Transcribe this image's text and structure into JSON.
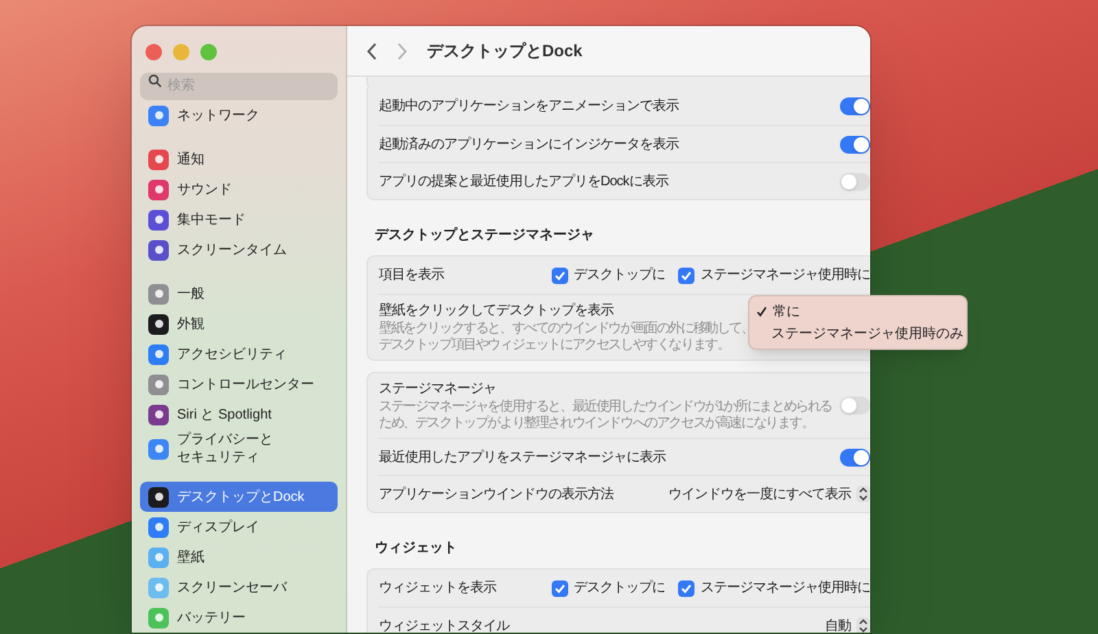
{
  "window": {
    "title": "デスクトップとDock",
    "controls": [
      {
        "color": "#ec5f57"
      },
      {
        "color": "#e8b73a"
      },
      {
        "color": "#5fc33f"
      }
    ]
  },
  "sidebar": {
    "search": {
      "placeholder": "検索"
    },
    "groups": [
      [
        {
          "label": "ネットワーク",
          "color": "#3b82f6",
          "selected": false
        }
      ],
      [
        {
          "label": "通知",
          "color": "#e5484d",
          "selected": false
        },
        {
          "label": "サウンド",
          "color": "#e0386a",
          "selected": false
        },
        {
          "label": "集中モード",
          "color": "#5b4fd6",
          "selected": false
        },
        {
          "label": "スクリーンタイム",
          "color": "#5a4fc9",
          "selected": false
        }
      ],
      [
        {
          "label": "一般",
          "color": "#8e8e93",
          "selected": false
        },
        {
          "label": "外観",
          "color": "#1c1c1e",
          "selected": false
        },
        {
          "label": "アクセシビリティ",
          "color": "#2f7df6",
          "selected": false
        },
        {
          "label": "コントロールセンター",
          "color": "#8e8e93",
          "selected": false
        },
        {
          "label": "Siri と Spotlight",
          "color": "#7a3b8f",
          "selected": false
        },
        {
          "label_lines": [
            "プライバシーと",
            "セキュリティ"
          ],
          "color": "#3d86f5",
          "selected": false
        }
      ],
      [
        {
          "label": "デスクトップとDock",
          "color": "#1c1c1e",
          "selected": true
        },
        {
          "label": "ディスプレイ",
          "color": "#2f7df6",
          "selected": false
        },
        {
          "label": "壁紙",
          "color": "#5ab0f0",
          "selected": false
        },
        {
          "label": "スクリーンセーバ",
          "color": "#6cbcf0",
          "selected": false
        },
        {
          "label": "バッテリー",
          "color": "#4cc25a",
          "selected": false
        }
      ]
    ]
  },
  "sections": [
    {
      "cards": [
        {
          "rows": [
            {
              "kind": "toggle",
              "label": "起動中のアプリケーションをアニメーションで表示",
              "on": true
            },
            {
              "kind": "toggle",
              "label": "起動済みのアプリケーションにインジケータを表示",
              "on": true
            },
            {
              "kind": "toggle",
              "label": "アプリの提案と最近使用したアプリをDockに表示",
              "on": false
            }
          ]
        }
      ]
    },
    {
      "title": "デスクトップとステージマネージャ",
      "cards": [
        {
          "rows": [
            {
              "kind": "checks",
              "label": "項目を表示",
              "options": [
                {
                  "label": "デスクトップに",
                  "checked": true
                },
                {
                  "label": "ステージマネージャ使用時に",
                  "checked": true
                }
              ]
            },
            {
              "kind": "info",
              "label": "壁紙をクリックしてデスクトップを表示",
              "description_lines": [
                "壁紙をクリックすると、すべてのウインドウが画面の外に移動して、",
                "デスクトップ項目やウィジェットにアクセスしやすくなります。"
              ]
            }
          ]
        },
        {
          "rows": [
            {
              "kind": "toggle",
              "label": "ステージマネージャ",
              "description_lines": [
                "ステージマネージャを使用すると、最近使用したウインドウが1か所にまとめられる",
                "ため、デスクトップがより整理されウインドウへのアクセスが高速になります。"
              ],
              "on": false
            },
            {
              "kind": "toggle",
              "label": "最近使用したアプリをステージマネージャに表示",
              "on": true
            },
            {
              "kind": "select",
              "label": "アプリケーションウインドウの表示方法",
              "value": "ウインドウを一度にすべて表示"
            }
          ]
        }
      ]
    },
    {
      "title": "ウィジェット",
      "cards": [
        {
          "rows": [
            {
              "kind": "checks",
              "label": "ウィジェットを表示",
              "options": [
                {
                  "label": "デスクトップに",
                  "checked": true
                },
                {
                  "label": "ステージマネージャ使用時に",
                  "checked": true
                }
              ]
            },
            {
              "kind": "select",
              "label": "ウィジェットスタイル",
              "value": "自動"
            }
          ]
        }
      ]
    }
  ],
  "popup_menu": {
    "items": [
      {
        "label": "常に",
        "selected": true
      },
      {
        "label": "ステージマネージャ使用時のみ",
        "selected": false
      }
    ]
  }
}
